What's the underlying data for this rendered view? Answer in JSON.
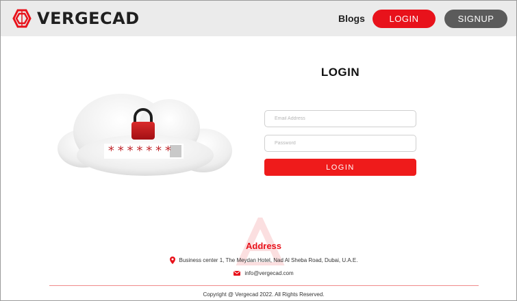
{
  "header": {
    "brand": "VERGECAD",
    "nav_blogs": "Blogs",
    "nav_login": "LOGIN",
    "nav_signup": "SIGNUP"
  },
  "login": {
    "title": "LOGIN",
    "email_placeholder": "Email Address",
    "password_placeholder": "Password",
    "submit_label": "LOGIN"
  },
  "illustration": {
    "masked_text": "*******",
    "icon": "padlock-icon"
  },
  "footer": {
    "address_title": "Address",
    "address": "Business center 1, The Meydan Hotel, Nad Al Sheba Road, Dubai, U.A.E.",
    "email": "info@vergecad.com",
    "copyright": "Copyright @ Vergecad 2022. All Rights Reserved."
  },
  "colors": {
    "accent": "#e8121b",
    "signup": "#5b5b5b",
    "navbar": "#ebebeb"
  }
}
